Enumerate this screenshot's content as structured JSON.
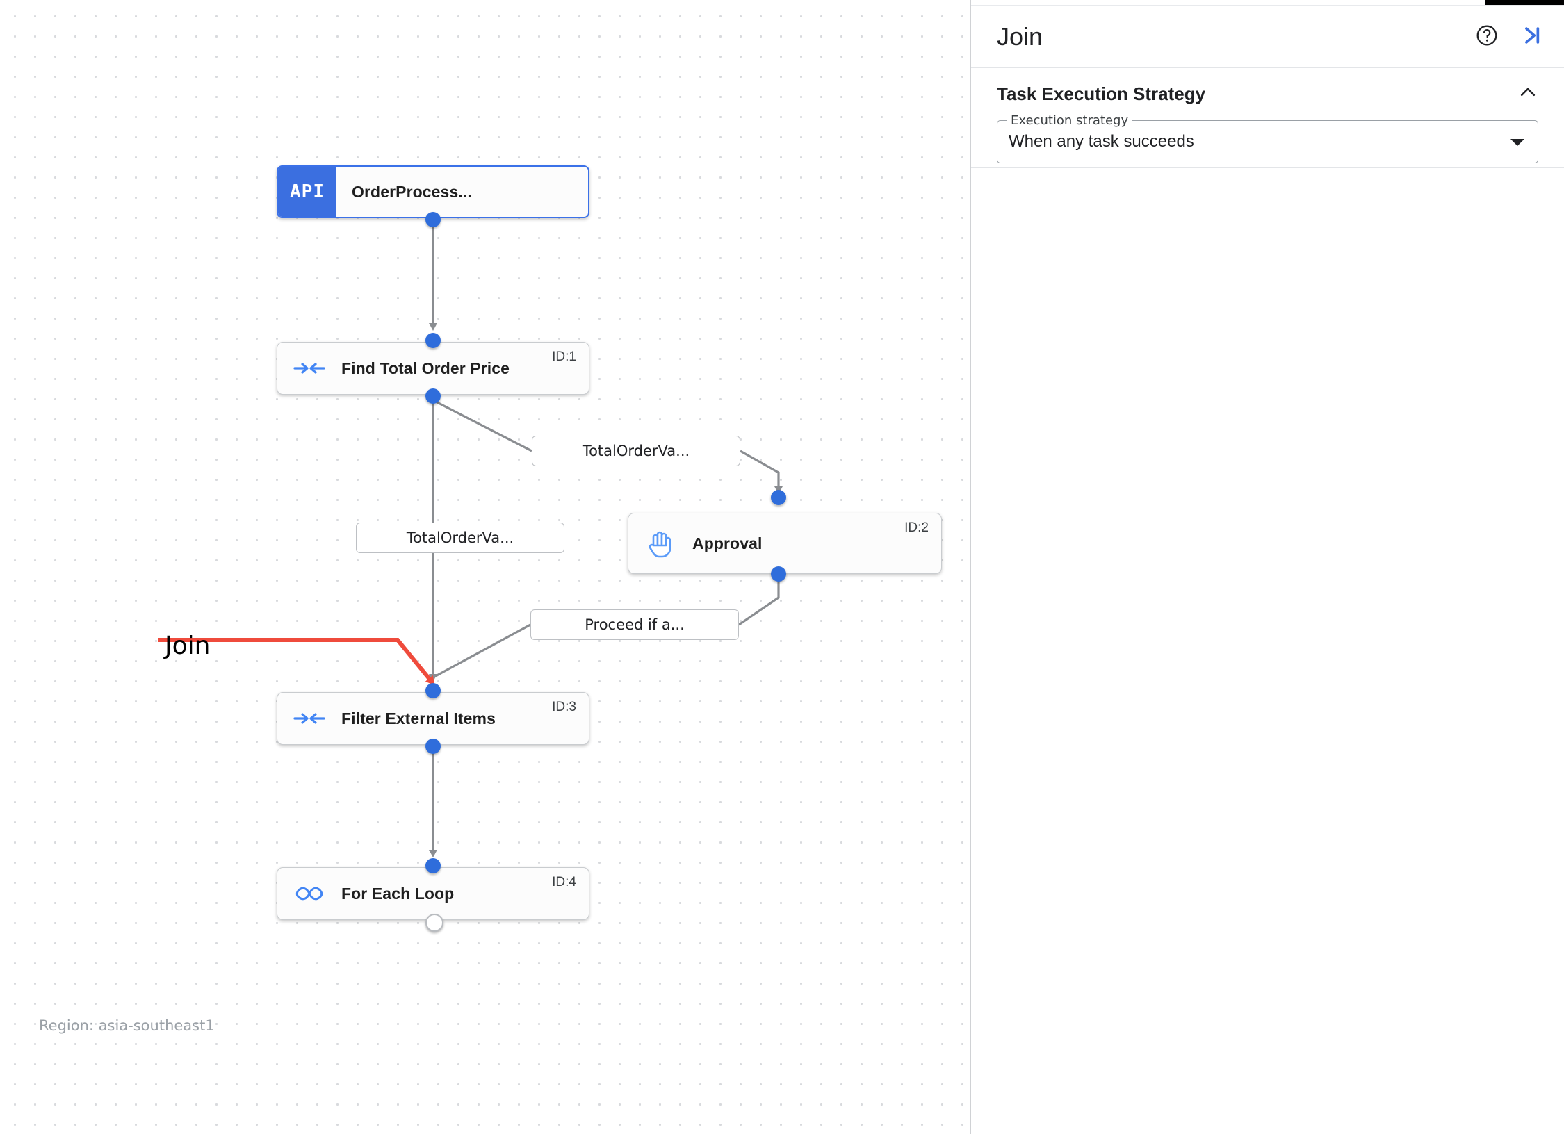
{
  "canvas": {
    "region_label": "Region: asia-southeast1",
    "annotation": {
      "text": "Join",
      "color": "#ef4b3c"
    },
    "nodes": [
      {
        "id": "trigger",
        "badge": "API",
        "title": "OrderProcess...",
        "id_label": "",
        "icon": "api-badge"
      },
      {
        "id": "find",
        "badge": "",
        "title": "Find Total Order Price",
        "id_label": "ID:1",
        "icon": "merge-arrows-icon"
      },
      {
        "id": "approval",
        "badge": "",
        "title": "Approval",
        "id_label": "ID:2",
        "icon": "raised-hand-icon"
      },
      {
        "id": "filter",
        "badge": "",
        "title": "Filter External Items",
        "id_label": "ID:3",
        "icon": "merge-arrows-icon"
      },
      {
        "id": "loop",
        "badge": "",
        "title": "For Each Loop",
        "id_label": "ID:4",
        "icon": "infinity-loop-icon"
      }
    ],
    "edge_labels": [
      {
        "id": "a",
        "text": "TotalOrderVa..."
      },
      {
        "id": "b",
        "text": "TotalOrderVa..."
      },
      {
        "id": "c",
        "text": "Proceed if a..."
      }
    ]
  },
  "panel": {
    "title": "Join",
    "help_icon": "help-circle-icon",
    "collapse_icon": "collapse-panel-icon",
    "section": {
      "title": "Task Execution Strategy",
      "chevron": "chevron-up-icon",
      "field": {
        "label": "Execution strategy",
        "value": "When any task succeeds",
        "arrow": "dropdown-arrow-icon"
      }
    }
  },
  "colors": {
    "accent_blue": "#3b6fe0",
    "connector_blue": "#2f6ddb",
    "annotation_red": "#ef4b3c",
    "edge_gray": "#8a8d91"
  }
}
